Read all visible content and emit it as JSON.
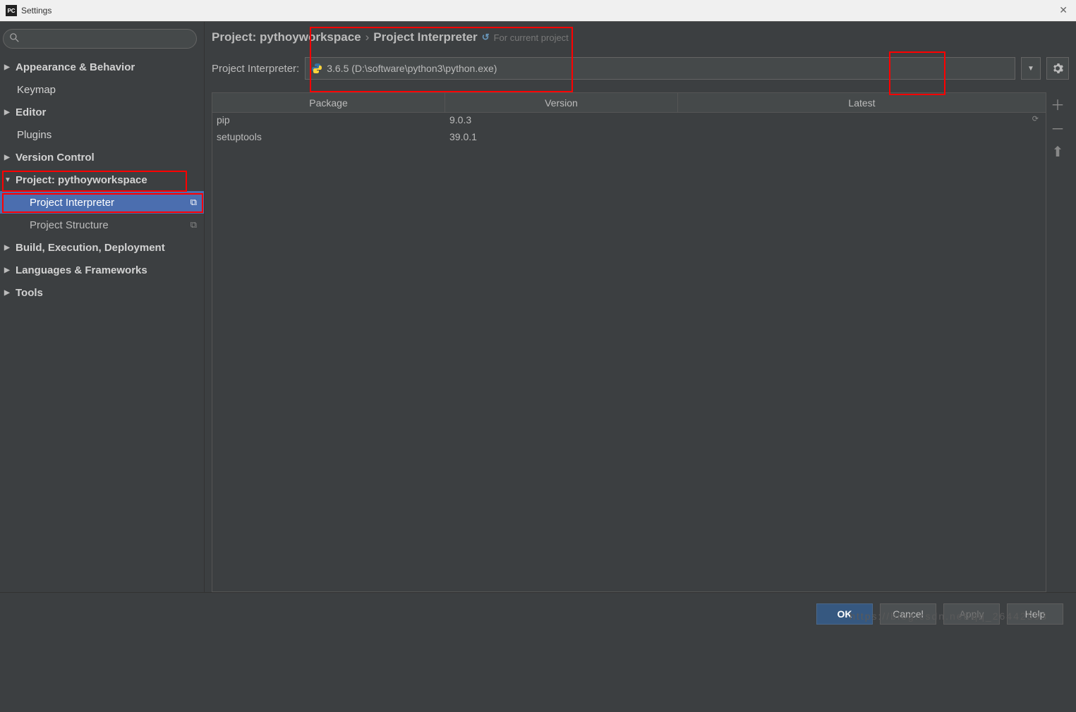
{
  "window": {
    "title": "Settings",
    "icon_label": "PC"
  },
  "sidebar": {
    "search_placeholder": "",
    "items": [
      {
        "label": "Appearance & Behavior",
        "arrow": "▶",
        "bold": true
      },
      {
        "label": "Keymap",
        "arrow": "",
        "bold": true,
        "child": true
      },
      {
        "label": "Editor",
        "arrow": "▶",
        "bold": true
      },
      {
        "label": "Plugins",
        "arrow": "",
        "bold": true,
        "child": true
      },
      {
        "label": "Version Control",
        "arrow": "▶",
        "bold": true
      },
      {
        "label": "Project: pythoyworkspace",
        "arrow": "▼",
        "bold": true
      },
      {
        "label": "Project Interpreter",
        "arrow": "",
        "grandchild": true,
        "selected": true,
        "copy": true
      },
      {
        "label": "Project Structure",
        "arrow": "",
        "grandchild": true,
        "copy": true
      },
      {
        "label": "Build, Execution, Deployment",
        "arrow": "▶",
        "bold": true
      },
      {
        "label": "Languages & Frameworks",
        "arrow": "▶",
        "bold": true
      },
      {
        "label": "Tools",
        "arrow": "▶",
        "bold": true
      }
    ]
  },
  "breadcrumb": {
    "prefix": "Project: pythoyworkspace",
    "sep": "›",
    "current": "Project Interpreter",
    "hint": "For current project"
  },
  "interpreter": {
    "label": "Project Interpreter:",
    "value": "3.6.5 (D:\\software\\python3\\python.exe)"
  },
  "packages": {
    "headers": {
      "package": "Package",
      "version": "Version",
      "latest": "Latest"
    },
    "rows": [
      {
        "name": "pip",
        "version": "9.0.3",
        "latest_icon": "⟳"
      },
      {
        "name": "setuptools",
        "version": "39.0.1",
        "latest_icon": ""
      }
    ]
  },
  "footer": {
    "ok": "OK",
    "cancel": "Cancel",
    "apply": "Apply",
    "help": "Help",
    "watermark": "https://blog.csdn.net/qq_26442553"
  }
}
